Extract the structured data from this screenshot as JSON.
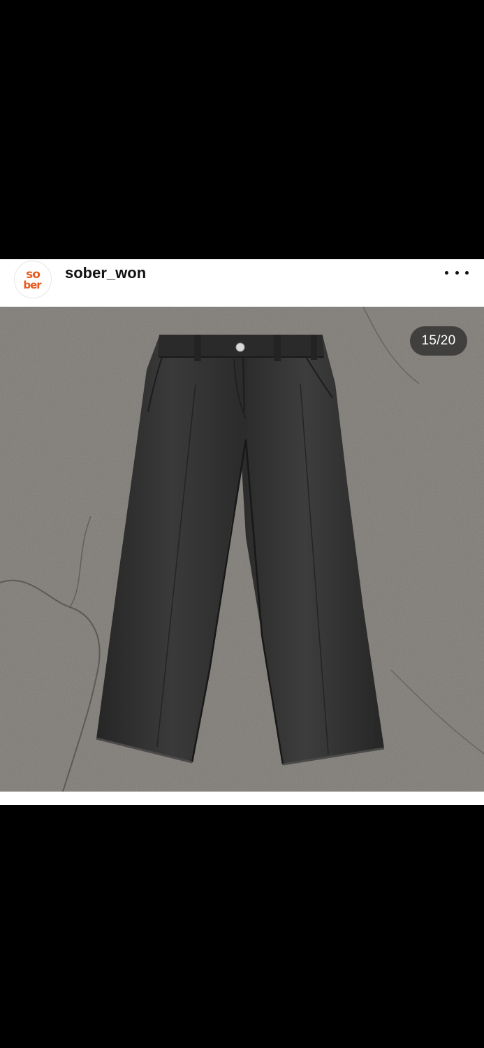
{
  "post": {
    "avatar": {
      "label": "sober avatar",
      "brand_color": "#e85a1e"
    },
    "username": "sober_won",
    "more_icon": "more-horizontal-icon",
    "media": {
      "description": "black trousers on asphalt",
      "counter": "15/20"
    }
  },
  "colors": {
    "background": "#000000",
    "card": "#ffffff",
    "text": "#111111",
    "counter_bg": "#262626"
  }
}
